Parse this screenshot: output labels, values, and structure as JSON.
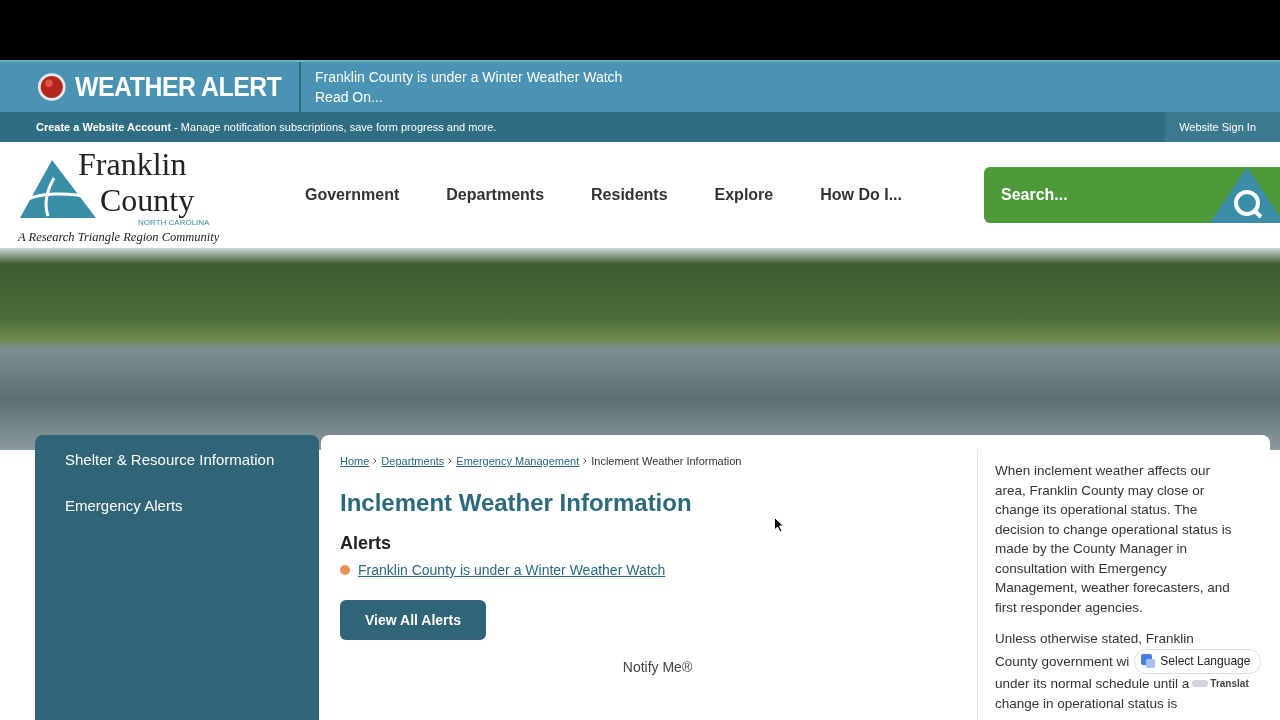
{
  "alert_bar": {
    "title": "WEATHER ALERT",
    "message": "Franklin County is under a Winter Weather Watch",
    "link": "Read On..."
  },
  "account_bar": {
    "text": "**Create a Website Account** - Manage notification subscriptions, save form progress and more.",
    "sign_in": "Website Sign In"
  },
  "logo": {
    "name_line_1": "Franklin",
    "name_line_2": "County",
    "state": "NORTH CAROLINA",
    "tagline": "A Research Triangle Region Community"
  },
  "nav": [
    "Government",
    "Departments",
    "Residents",
    "Explore",
    "How Do I..."
  ],
  "search": {
    "placeholder": "Search..."
  },
  "sidebar": {
    "items": [
      "Shelter & Resource Information",
      "Emergency Alerts"
    ]
  },
  "breadcrumb": [
    {
      "label": "Home",
      "kind": "link"
    },
    {
      "label": "Departments",
      "kind": "link"
    },
    {
      "label": "Emergency Management",
      "kind": "link"
    },
    {
      "label": "Inclement Weather Information",
      "kind": "current"
    }
  ],
  "page_title": "Inclement Weather Information",
  "alerts": {
    "heading": "Alerts",
    "items": [
      "Franklin County is under a Winter Weather Watch"
    ]
  },
  "view_all_button": "View All Alerts",
  "notify": "Notify Me®",
  "aside": {
    "paragraph_1": "When inclement weather affects our area, Franklin County may close or change its operational status. The decision to change operational status is made by the County Manager in consultation with Emergency Management, weather forecasters, and first responder agencies.",
    "paragraph_2_lines": [
      "Unless otherwise stated, Franklin",
      "County government wi",
      "under its normal schedule until a",
      "change in operational status is"
    ]
  },
  "translate": {
    "select": "Select Language",
    "label": "Translat"
  }
}
